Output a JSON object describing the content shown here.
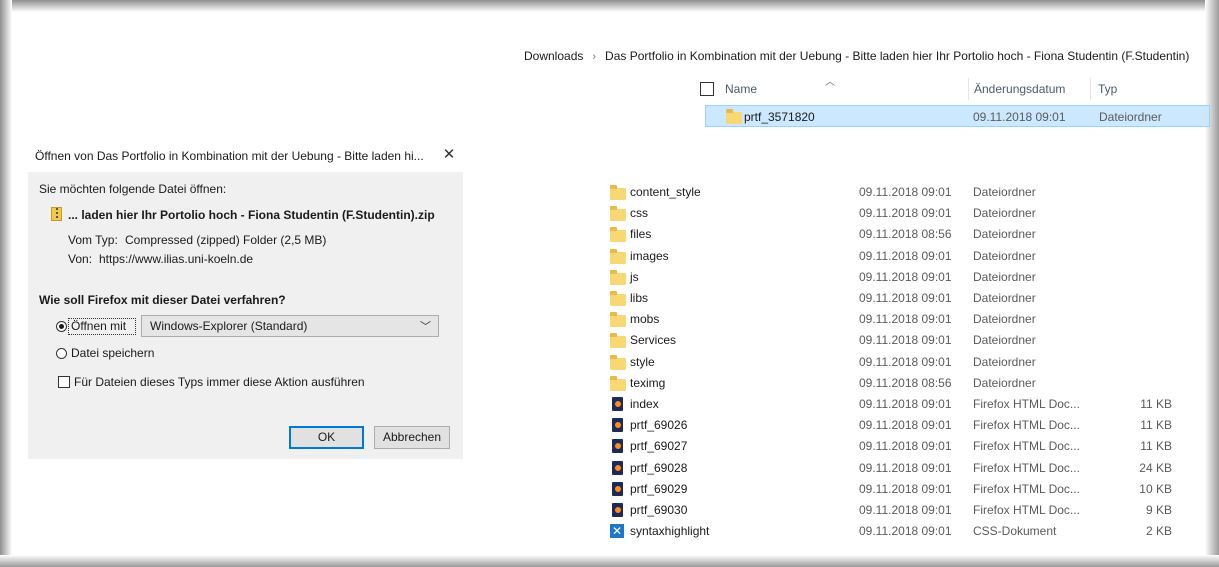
{
  "breadcrumb": {
    "items": [
      "Downloads",
      "Das Portfolio in Kombination mit der Uebung - Bitte laden hier Ihr Portolio hoch - Fiona Studentin (F.Studentin)"
    ],
    "separator": "›"
  },
  "columns": {
    "name": "Name",
    "date": "Änderungsdatum",
    "type": "Typ"
  },
  "top_folder": {
    "name": "prtf_3571820",
    "date": "09.11.2018 09:01",
    "type": "Dateiordner"
  },
  "files": [
    {
      "icon": "folder-icon",
      "name": "content_style",
      "date": "09.11.2018 09:01",
      "type": "Dateiordner",
      "size": ""
    },
    {
      "icon": "folder-icon",
      "name": "css",
      "date": "09.11.2018 09:01",
      "type": "Dateiordner",
      "size": ""
    },
    {
      "icon": "folder-icon",
      "name": "files",
      "date": "09.11.2018 08:56",
      "type": "Dateiordner",
      "size": ""
    },
    {
      "icon": "folder-icon",
      "name": "images",
      "date": "09.11.2018 09:01",
      "type": "Dateiordner",
      "size": ""
    },
    {
      "icon": "folder-icon",
      "name": "js",
      "date": "09.11.2018 09:01",
      "type": "Dateiordner",
      "size": ""
    },
    {
      "icon": "folder-icon",
      "name": "libs",
      "date": "09.11.2018 09:01",
      "type": "Dateiordner",
      "size": ""
    },
    {
      "icon": "folder-icon",
      "name": "mobs",
      "date": "09.11.2018 09:01",
      "type": "Dateiordner",
      "size": ""
    },
    {
      "icon": "folder-icon",
      "name": "Services",
      "date": "09.11.2018 09:01",
      "type": "Dateiordner",
      "size": ""
    },
    {
      "icon": "folder-icon",
      "name": "style",
      "date": "09.11.2018 09:01",
      "type": "Dateiordner",
      "size": ""
    },
    {
      "icon": "folder-icon",
      "name": "teximg",
      "date": "09.11.2018 08:56",
      "type": "Dateiordner",
      "size": ""
    },
    {
      "icon": "firefox-html-icon",
      "name": "index",
      "date": "09.11.2018 09:01",
      "type": "Firefox HTML Doc...",
      "size": "11 KB"
    },
    {
      "icon": "firefox-html-icon",
      "name": "prtf_69026",
      "date": "09.11.2018 09:01",
      "type": "Firefox HTML Doc...",
      "size": "11 KB"
    },
    {
      "icon": "firefox-html-icon",
      "name": "prtf_69027",
      "date": "09.11.2018 09:01",
      "type": "Firefox HTML Doc...",
      "size": "11 KB"
    },
    {
      "icon": "firefox-html-icon",
      "name": "prtf_69028",
      "date": "09.11.2018 09:01",
      "type": "Firefox HTML Doc...",
      "size": "24 KB"
    },
    {
      "icon": "firefox-html-icon",
      "name": "prtf_69029",
      "date": "09.11.2018 09:01",
      "type": "Firefox HTML Doc...",
      "size": "10 KB"
    },
    {
      "icon": "firefox-html-icon",
      "name": "prtf_69030",
      "date": "09.11.2018 09:01",
      "type": "Firefox HTML Doc...",
      "size": "9 KB"
    },
    {
      "icon": "css-document-icon",
      "name": "syntaxhighlight",
      "date": "09.11.2018 09:01",
      "type": "CSS-Dokument",
      "size": "2 KB"
    }
  ],
  "dialog": {
    "title": "Öffnen von Das Portfolio in Kombination mit der Uebung - Bitte laden hi...",
    "close": "✕",
    "intro": "Sie möchten folgende Datei öffnen:",
    "filename": "... laden hier Ihr Portolio hoch - Fiona Studentin (F.Studentin).zip",
    "type_label": "Vom Typ:",
    "type_value": "Compressed (zipped) Folder (2,5 MB)",
    "from_label": "Von:",
    "from_value": "https://www.ilias.uni-koeln.de",
    "question": "Wie soll Firefox mit dieser Datei verfahren?",
    "open_with_label": "Öffnen mit",
    "open_with_value": "Windows-Explorer (Standard)",
    "save_label": "Datei speichern",
    "always_label": "Für Dateien dieses Typs immer diese Aktion ausführen",
    "ok": "OK",
    "cancel": "Abbrechen"
  }
}
